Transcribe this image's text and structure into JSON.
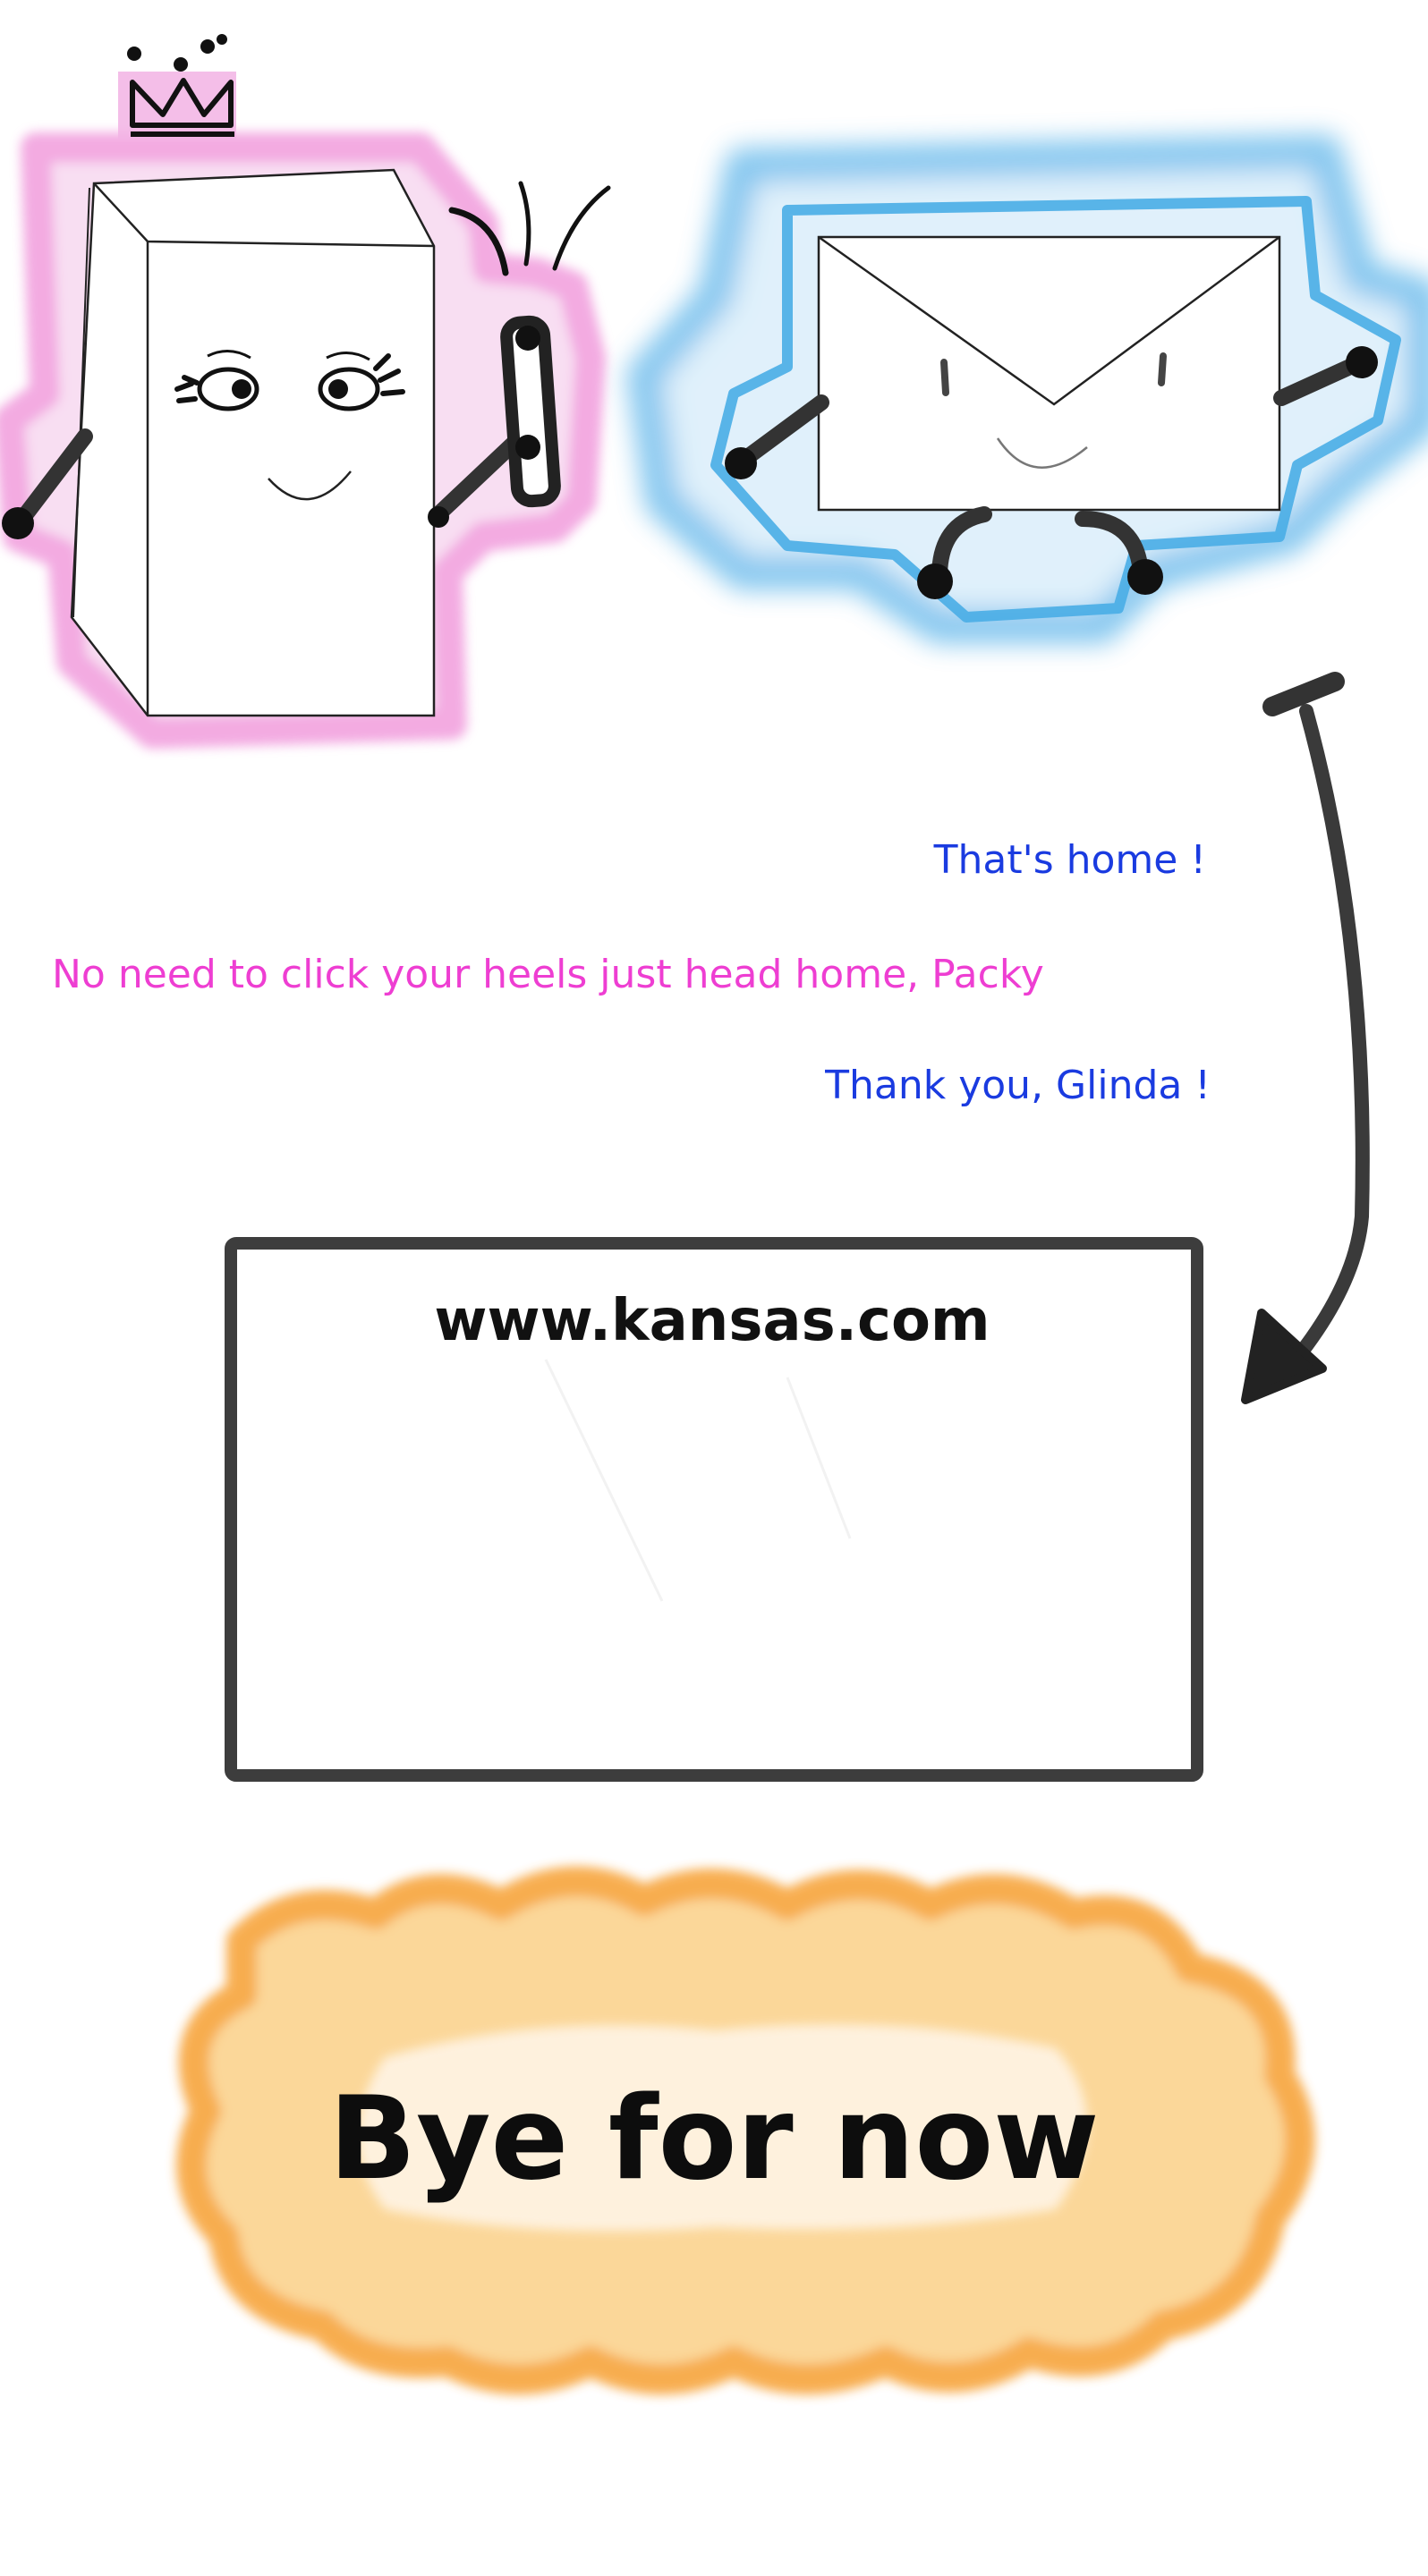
{
  "colors": {
    "glinda_outline": "#ef8fd8",
    "packy_outline": "#5fb6ea",
    "bye_cloud": "#f7a53c",
    "blue_text": "#1a3be0",
    "pink_text": "#ee3ed2",
    "ink": "#111111"
  },
  "dialogue": {
    "line1": "That's home !",
    "line2": "No need to click your heels just head home, Packy",
    "line3": "Thank you, Glinda !"
  },
  "screen": {
    "url": "www.kansas.com"
  },
  "closing": {
    "text": "Bye for now"
  },
  "icons": {
    "glinda": "box-character-with-crown-and-wand",
    "packy": "envelope-character",
    "crown": "crown-icon",
    "wand": "wand-icon",
    "arrow": "curved-arrow-icon"
  }
}
